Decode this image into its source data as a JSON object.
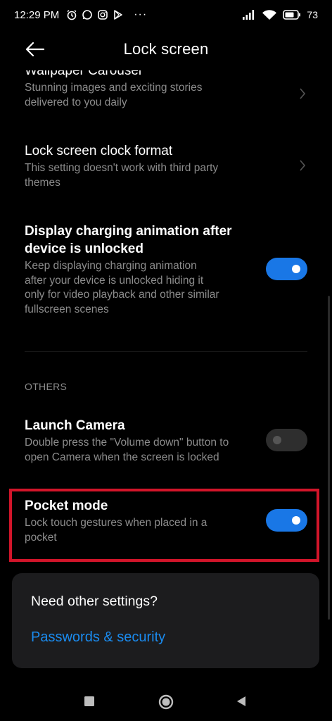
{
  "status_bar": {
    "time": "12:29 PM",
    "more": "···",
    "battery": "73"
  },
  "header": {
    "title": "Lock screen"
  },
  "settings": {
    "wallpaper": {
      "title": "Wallpaper Carousel",
      "desc_line1": "Stunning images and exciting stories",
      "desc_line2": "delivered to you daily"
    },
    "clock_format": {
      "title": "Lock screen clock format",
      "desc_line1": "This setting doesn't work with third party",
      "desc_line2": "themes"
    },
    "charging": {
      "title_line1": "Display charging animation after",
      "title_line2": "device is unlocked",
      "desc_line1": "Keep displaying charging animation",
      "desc_line2": "after your device is unlocked hiding it",
      "desc_line3": "only for video playback and other similar",
      "desc_line4": "fullscreen scenes",
      "enabled": true
    },
    "section_others": "OTHERS",
    "launch_camera": {
      "title": "Launch Camera",
      "desc_line1": "Double press the \"Volume down\" button to",
      "desc_line2": "open Camera when the screen is locked",
      "enabled": false
    },
    "pocket_mode": {
      "title": "Pocket mode",
      "desc_line1": "Lock touch gestures when placed in a",
      "desc_line2": "pocket",
      "enabled": true
    }
  },
  "card": {
    "title": "Need other settings?",
    "link": "Passwords & security"
  },
  "colors": {
    "accent": "#1977e6",
    "link": "#1a8bef",
    "highlight": "#d2152a",
    "background": "#000000"
  }
}
